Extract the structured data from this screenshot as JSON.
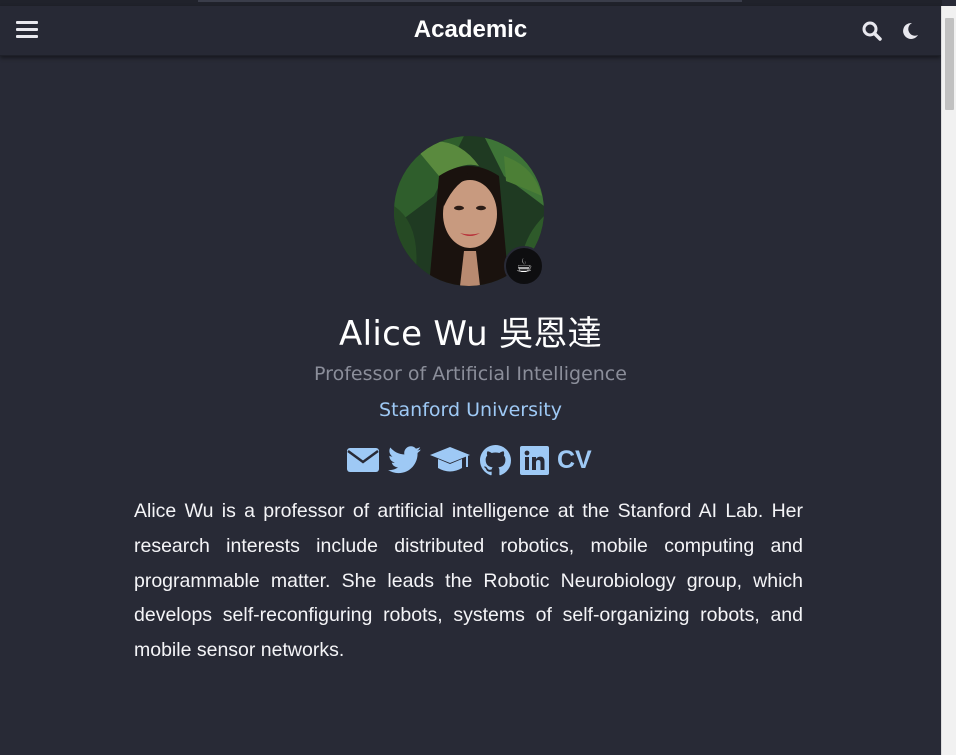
{
  "navbar": {
    "brand": "Academic",
    "menu_icon": "hamburger-menu-icon",
    "search_icon": "search-icon",
    "theme_icon": "moon-icon"
  },
  "profile": {
    "name": "Alice Wu 吳恩達",
    "role": "Professor of Artificial Intelligence",
    "organization": "Stanford University",
    "status_emoji": "☕",
    "avatar_icon": "avatar-photo"
  },
  "social_links": [
    {
      "icon": "envelope-icon"
    },
    {
      "icon": "twitter-icon"
    },
    {
      "icon": "graduation-cap-icon"
    },
    {
      "icon": "github-icon"
    },
    {
      "icon": "linkedin-icon"
    },
    {
      "label": "CV"
    }
  ],
  "bio": "Alice Wu is a professor of artificial intelligence at the Stanford AI Lab. Her research interests include distributed robotics, mobile computing and programmable matter. She leads the Robotic Neurobiology group, which develops self-reconfiguring robots, systems of self-organizing robots, and mobile sensor networks.",
  "colors": {
    "background": "#282a36",
    "navbar": "#272935",
    "link": "#9ec9f5",
    "muted": "#8b8e9a",
    "text": "#f4f4f7"
  }
}
